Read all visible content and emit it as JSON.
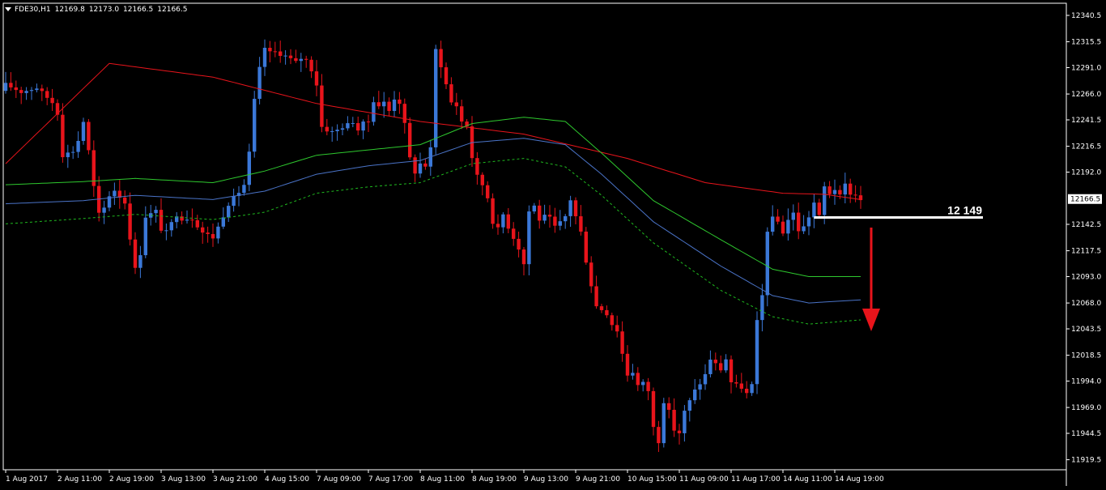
{
  "header": {
    "symbol": "FDE30,H1",
    "open": "12169.8",
    "high": "12173.0",
    "low": "12166.5",
    "close": "12166.5"
  },
  "colors": {
    "background": "#000000",
    "bull": "#3b78d8",
    "bear": "#e8141b",
    "ma_red": "#e8141b",
    "env_green": "#2ec82e",
    "env_blue": "#4a73c7",
    "env_dash": "#1fb91f",
    "axis": "#ffffff",
    "level": "#ffffff",
    "arrow": "#e8141b"
  },
  "chart_data": {
    "type": "candlestick",
    "ylim": [
      11910,
      12352
    ],
    "y_ticks": [
      "12340.5",
      "12315.5",
      "12291.0",
      "12266.0",
      "12241.5",
      "12216.5",
      "12192.0",
      "12142.5",
      "12117.5",
      "12093.0",
      "12068.0",
      "12043.5",
      "12018.5",
      "11994.0",
      "11969.0",
      "11944.5",
      "11919.5"
    ],
    "x_ticks": [
      "1 Aug 2017",
      "2 Aug 11:00",
      "2 Aug 19:00",
      "3 Aug 13:00",
      "3 Aug 21:00",
      "4 Aug 15:00",
      "7 Aug 09:00",
      "7 Aug 17:00",
      "8 Aug 11:00",
      "8 Aug 19:00",
      "9 Aug 13:00",
      "9 Aug 21:00",
      "10 Aug 15:00",
      "11 Aug 09:00",
      "11 Aug 17:00",
      "14 Aug 11:00",
      "14 Aug 19:00"
    ],
    "current_price": "12166.5",
    "level_label": "12 149",
    "level_value": 12149,
    "close_path": [
      [
        0,
        12275
      ],
      [
        3,
        12268
      ],
      [
        6,
        12272
      ],
      [
        9,
        12258
      ],
      [
        10,
        12248
      ],
      [
        11,
        12208
      ],
      [
        13,
        12212
      ],
      [
        14,
        12222
      ],
      [
        15,
        12240
      ],
      [
        16,
        12212
      ],
      [
        17,
        12178
      ],
      [
        18,
        12152
      ],
      [
        19,
        12158
      ],
      [
        20,
        12170
      ],
      [
        21,
        12175
      ],
      [
        23,
        12163
      ],
      [
        24,
        12130
      ],
      [
        25,
        12100
      ],
      [
        26,
        12115
      ],
      [
        27,
        12150
      ],
      [
        29,
        12155
      ],
      [
        30,
        12138
      ],
      [
        31,
        12135
      ],
      [
        33,
        12152
      ],
      [
        34,
        12148
      ],
      [
        36,
        12148
      ],
      [
        38,
        12135
      ],
      [
        40,
        12130
      ],
      [
        41,
        12140
      ],
      [
        43,
        12162
      ],
      [
        45,
        12173
      ],
      [
        46,
        12180
      ],
      [
        47,
        12210
      ],
      [
        48,
        12260
      ],
      [
        49,
        12290
      ],
      [
        50,
        12310
      ],
      [
        51,
        12305
      ],
      [
        52,
        12306
      ],
      [
        54,
        12302
      ],
      [
        56,
        12296
      ],
      [
        57,
        12300
      ],
      [
        58,
        12298
      ],
      [
        59,
        12289
      ],
      [
        60,
        12275
      ],
      [
        61,
        12235
      ],
      [
        62,
        12232
      ],
      [
        63,
        12230
      ],
      [
        64,
        12232
      ],
      [
        65,
        12235
      ],
      [
        66,
        12237
      ],
      [
        67,
        12240
      ],
      [
        68,
        12232
      ],
      [
        69,
        12238
      ],
      [
        70,
        12240
      ],
      [
        71,
        12260
      ],
      [
        72,
        12255
      ],
      [
        73,
        12258
      ],
      [
        74,
        12250
      ],
      [
        75,
        12262
      ],
      [
        76,
        12258
      ],
      [
        77,
        12237
      ],
      [
        78,
        12205
      ],
      [
        79,
        12192
      ],
      [
        80,
        12200
      ],
      [
        81,
        12198
      ],
      [
        82,
        12214
      ],
      [
        83,
        12308
      ],
      [
        84,
        12293
      ],
      [
        85,
        12275
      ],
      [
        86,
        12258
      ],
      [
        87,
        12255
      ],
      [
        88,
        12240
      ],
      [
        89,
        12236
      ],
      [
        90,
        12206
      ],
      [
        91,
        12188
      ],
      [
        92,
        12180
      ],
      [
        93,
        12168
      ],
      [
        94,
        12145
      ],
      [
        95,
        12138
      ],
      [
        96,
        12152
      ],
      [
        97,
        12140
      ],
      [
        98,
        12130
      ],
      [
        99,
        12120
      ],
      [
        100,
        12105
      ],
      [
        101,
        12155
      ],
      [
        102,
        12160
      ],
      [
        103,
        12147
      ],
      [
        104,
        12150
      ],
      [
        105,
        12148
      ],
      [
        106,
        12140
      ],
      [
        107,
        12144
      ],
      [
        108,
        12150
      ],
      [
        109,
        12166
      ],
      [
        110,
        12150
      ],
      [
        111,
        12135
      ],
      [
        112,
        12108
      ],
      [
        113,
        12085
      ],
      [
        114,
        12065
      ],
      [
        115,
        12062
      ],
      [
        116,
        12058
      ],
      [
        117,
        12048
      ],
      [
        118,
        12042
      ],
      [
        119,
        12020
      ],
      [
        120,
        12000
      ],
      [
        121,
        12003
      ],
      [
        122,
        11990
      ],
      [
        123,
        11992
      ],
      [
        124,
        11985
      ],
      [
        125,
        11950
      ],
      [
        126,
        11937
      ],
      [
        127,
        11975
      ],
      [
        128,
        11965
      ],
      [
        129,
        11948
      ],
      [
        130,
        11945
      ],
      [
        131,
        11965
      ],
      [
        132,
        11975
      ],
      [
        133,
        11985
      ],
      [
        134,
        11992
      ],
      [
        135,
        12000
      ],
      [
        136,
        12015
      ],
      [
        137,
        12010
      ],
      [
        138,
        12005
      ],
      [
        139,
        12015
      ],
      [
        140,
        11993
      ],
      [
        141,
        11990
      ],
      [
        142,
        11988
      ],
      [
        143,
        11982
      ],
      [
        144,
        11990
      ],
      [
        145,
        12050
      ],
      [
        146,
        12075
      ],
      [
        147,
        12137
      ],
      [
        148,
        12148
      ],
      [
        149,
        12145
      ],
      [
        150,
        12135
      ],
      [
        151,
        12147
      ],
      [
        152,
        12153
      ],
      [
        153,
        12137
      ],
      [
        154,
        12140
      ],
      [
        155,
        12150
      ],
      [
        156,
        12163
      ],
      [
        157,
        12150
      ],
      [
        158,
        12178
      ],
      [
        159,
        12172
      ],
      [
        160,
        12176
      ],
      [
        161,
        12169
      ],
      [
        162,
        12180
      ],
      [
        163,
        12172
      ],
      [
        164,
        12170
      ],
      [
        165,
        12166.5
      ]
    ],
    "series": [
      {
        "name": "",
        "style": "red",
        "points": [
          [
            0,
            12200
          ],
          [
            20,
            12295
          ],
          [
            40,
            12282
          ],
          [
            60,
            12257
          ],
          [
            80,
            12240
          ],
          [
            100,
            12228
          ],
          [
            120,
            12205
          ],
          [
            135,
            12182
          ],
          [
            150,
            12172
          ],
          [
            158,
            12171
          ],
          [
            165,
            12166
          ]
        ]
      },
      {
        "name": "",
        "style": "green",
        "points": [
          [
            0,
            12180
          ],
          [
            15,
            12183
          ],
          [
            25,
            12186
          ],
          [
            40,
            12182
          ],
          [
            50,
            12193
          ],
          [
            60,
            12208
          ],
          [
            70,
            12213
          ],
          [
            80,
            12218
          ],
          [
            90,
            12238
          ],
          [
            100,
            12244
          ],
          [
            108,
            12240
          ],
          [
            115,
            12210
          ],
          [
            125,
            12165
          ],
          [
            138,
            12128
          ],
          [
            148,
            12100
          ],
          [
            155,
            12093
          ],
          [
            165,
            12093
          ]
        ]
      },
      {
        "name": "",
        "style": "blue",
        "points": [
          [
            0,
            12162
          ],
          [
            15,
            12165
          ],
          [
            25,
            12170
          ],
          [
            40,
            12166
          ],
          [
            50,
            12174
          ],
          [
            60,
            12190
          ],
          [
            70,
            12198
          ],
          [
            80,
            12203
          ],
          [
            90,
            12220
          ],
          [
            100,
            12224
          ],
          [
            108,
            12218
          ],
          [
            115,
            12190
          ],
          [
            125,
            12145
          ],
          [
            138,
            12103
          ],
          [
            148,
            12075
          ],
          [
            155,
            12068
          ],
          [
            165,
            12071
          ]
        ]
      },
      {
        "name": "",
        "style": "dashed",
        "points": [
          [
            0,
            12143
          ],
          [
            15,
            12148
          ],
          [
            25,
            12152
          ],
          [
            40,
            12147
          ],
          [
            50,
            12154
          ],
          [
            60,
            12172
          ],
          [
            70,
            12178
          ],
          [
            80,
            12182
          ],
          [
            90,
            12200
          ],
          [
            100,
            12205
          ],
          [
            108,
            12197
          ],
          [
            115,
            12170
          ],
          [
            125,
            12125
          ],
          [
            138,
            12080
          ],
          [
            148,
            12055
          ],
          [
            155,
            12048
          ],
          [
            165,
            12052
          ]
        ]
      }
    ]
  }
}
